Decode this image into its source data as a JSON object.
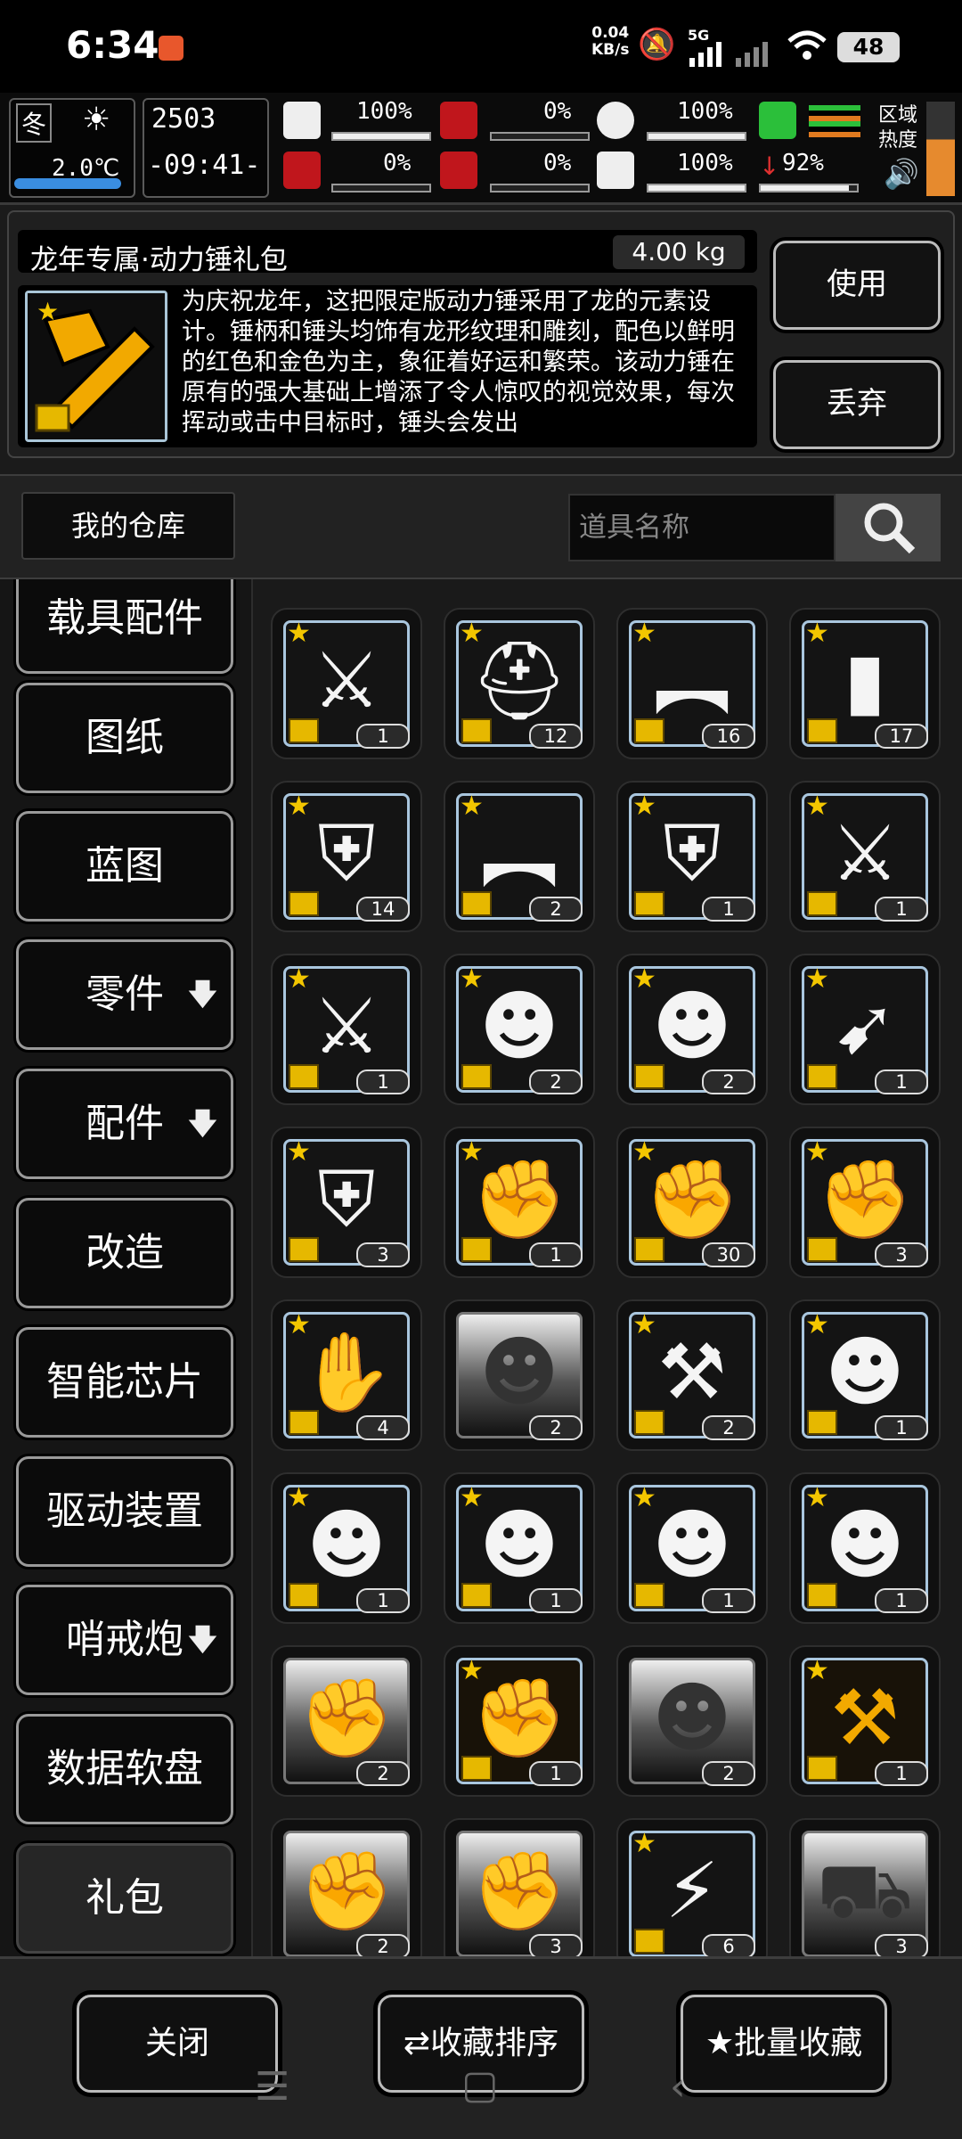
{
  "status_bar": {
    "time": "6:34",
    "net_speed": "0.04",
    "net_unit": "KB/s",
    "battery": "48",
    "signal_label": "5G"
  },
  "hud": {
    "season": "冬",
    "temperature": "2.0℃",
    "day": "2503",
    "clock": "-09:41-",
    "health_pct": "100%",
    "stomach_pct": "0%",
    "water_pct": "100%",
    "infection_pct": "0%",
    "blood_pct": "0%",
    "mood_pct": "100%",
    "stamina_pct": "92%",
    "zone_heat_label": "区域热度",
    "health_fill": 1.0,
    "stomach_fill": 0,
    "water_fill": 1.0,
    "infection_fill": 0,
    "blood_fill": 0,
    "mood_fill": 1.0
  },
  "detail": {
    "item_name": "龙年专属·动力锤礼包",
    "weight": "4.00 kg",
    "description": "为庆祝龙年，这把限定版动力锤采用了龙的元素设计。锤柄和锤头均饰有龙形纹理和雕刻，配色以鲜明的红色和金色为主，象征着好运和繁荣。该动力锤在原有的强大基础上增添了令人惊叹的视觉效果，每次挥动或击中目标时，锤头会发出",
    "use_label": "使用",
    "discard_label": "丢弃"
  },
  "warehouse": {
    "title": "我的仓库",
    "search_placeholder": "道具名称"
  },
  "categories": [
    {
      "label": "载具配件"
    },
    {
      "label": "图纸"
    },
    {
      "label": "蓝图"
    },
    {
      "label": "零件",
      "arrow": "🡇"
    },
    {
      "label": "配件",
      "arrow": "🡇"
    },
    {
      "label": "改造"
    },
    {
      "label": "智能芯片"
    },
    {
      "label": "驱动装置"
    },
    {
      "label": "哨戒炮",
      "arrow": "🡇"
    },
    {
      "label": "数据软盘"
    },
    {
      "label": "礼包"
    }
  ],
  "items": [
    {
      "icon": "sword-icon",
      "count": "1",
      "style": "gift"
    },
    {
      "icon": "helmet-icon",
      "count": "12",
      "style": "gift"
    },
    {
      "icon": "rifle-icon",
      "count": "16",
      "style": "gift"
    },
    {
      "icon": "riot-shield-icon",
      "count": "17",
      "style": "gift"
    },
    {
      "icon": "armor-vest-icon",
      "count": "14",
      "style": "gift"
    },
    {
      "icon": "sniper-rifle-icon",
      "count": "2",
      "style": "gift"
    },
    {
      "icon": "tactical-vest-icon",
      "count": "1",
      "style": "gift"
    },
    {
      "icon": "spear-icon",
      "count": "1",
      "style": "gift"
    },
    {
      "icon": "katana-icon",
      "count": "1",
      "style": "gift"
    },
    {
      "icon": "beast-head-icon",
      "count": "2",
      "style": "gift"
    },
    {
      "icon": "lion-armor-icon",
      "count": "2",
      "style": "gift"
    },
    {
      "icon": "crossbow-icon",
      "count": "1",
      "style": "gift"
    },
    {
      "icon": "power-armor-icon",
      "count": "3",
      "style": "gift"
    },
    {
      "icon": "gauntlet-icon",
      "count": "1",
      "style": "gift"
    },
    {
      "icon": "dragon-arm-icon",
      "count": "30",
      "style": "gift"
    },
    {
      "icon": "fist-icon",
      "count": "3",
      "style": "gift"
    },
    {
      "icon": "gloves-icon",
      "count": "4",
      "style": "gift"
    },
    {
      "icon": "dark-armor-icon",
      "count": "2",
      "style": "dark"
    },
    {
      "icon": "golden-hammer-icon",
      "count": "2",
      "style": "gift"
    },
    {
      "icon": "bear-suit-icon",
      "count": "1",
      "style": "gift"
    },
    {
      "icon": "raccoon-suit-icon",
      "count": "1",
      "style": "gift"
    },
    {
      "icon": "rabbit-hat-icon",
      "count": "1",
      "style": "gift"
    },
    {
      "icon": "leopard-hat-icon",
      "count": "1",
      "style": "gift"
    },
    {
      "icon": "pet-backpack-icon",
      "count": "1",
      "style": "gift"
    },
    {
      "icon": "dark-gauntlet-icon",
      "count": "2",
      "style": "dark"
    },
    {
      "icon": "gold-lion-arm-icon",
      "count": "1",
      "style": "gold"
    },
    {
      "icon": "dark-dragon-icon",
      "count": "2",
      "style": "dark"
    },
    {
      "icon": "gold-dragon-hammer-icon",
      "count": "1",
      "style": "gold"
    },
    {
      "icon": "dark-arm-icon",
      "count": "2",
      "style": "dark"
    },
    {
      "icon": "dark-claw-icon",
      "count": "3",
      "style": "dark"
    },
    {
      "icon": "scorpion-icon",
      "count": "6",
      "style": "gift"
    },
    {
      "icon": "dark-vehicle-icon",
      "count": "3",
      "style": "dark"
    }
  ],
  "bottom": {
    "close_label": "关闭",
    "sort_label": "收藏排序",
    "batch_label": "批量收藏"
  }
}
